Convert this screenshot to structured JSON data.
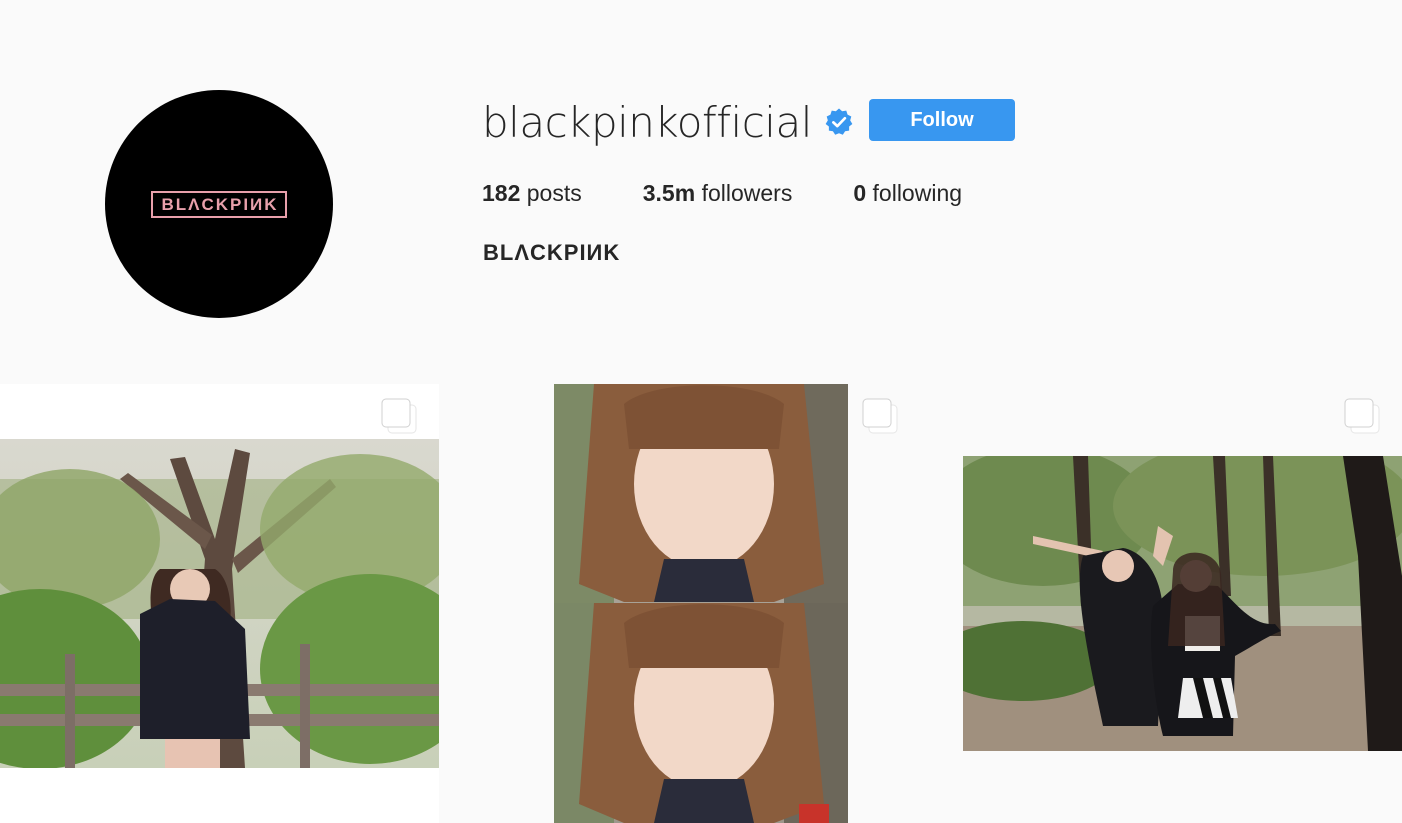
{
  "profile": {
    "username": "blackpinkofficial",
    "verified": true,
    "follow_label": "Follow",
    "avatar_text": "BLΛCKPIИK",
    "full_name": "BLΛCKPIИK",
    "stats": {
      "posts_count": "182",
      "posts_label": "posts",
      "followers_count": "3.5m",
      "followers_label": "followers",
      "following_count": "0",
      "following_label": "following"
    }
  },
  "posts": [
    {
      "icon": "multiple-photos-icon",
      "description": "outdoor-trees-fence"
    },
    {
      "icon": "multiple-photos-icon",
      "description": "selfie-collage"
    },
    {
      "icon": "multiple-photos-icon",
      "description": "park-path-trees"
    }
  ],
  "colors": {
    "background": "#fafafa",
    "follow_button": "#3897f0",
    "verified_badge": "#3897f0",
    "avatar_bg": "#000000",
    "logo_pink": "#e8a0ab"
  }
}
